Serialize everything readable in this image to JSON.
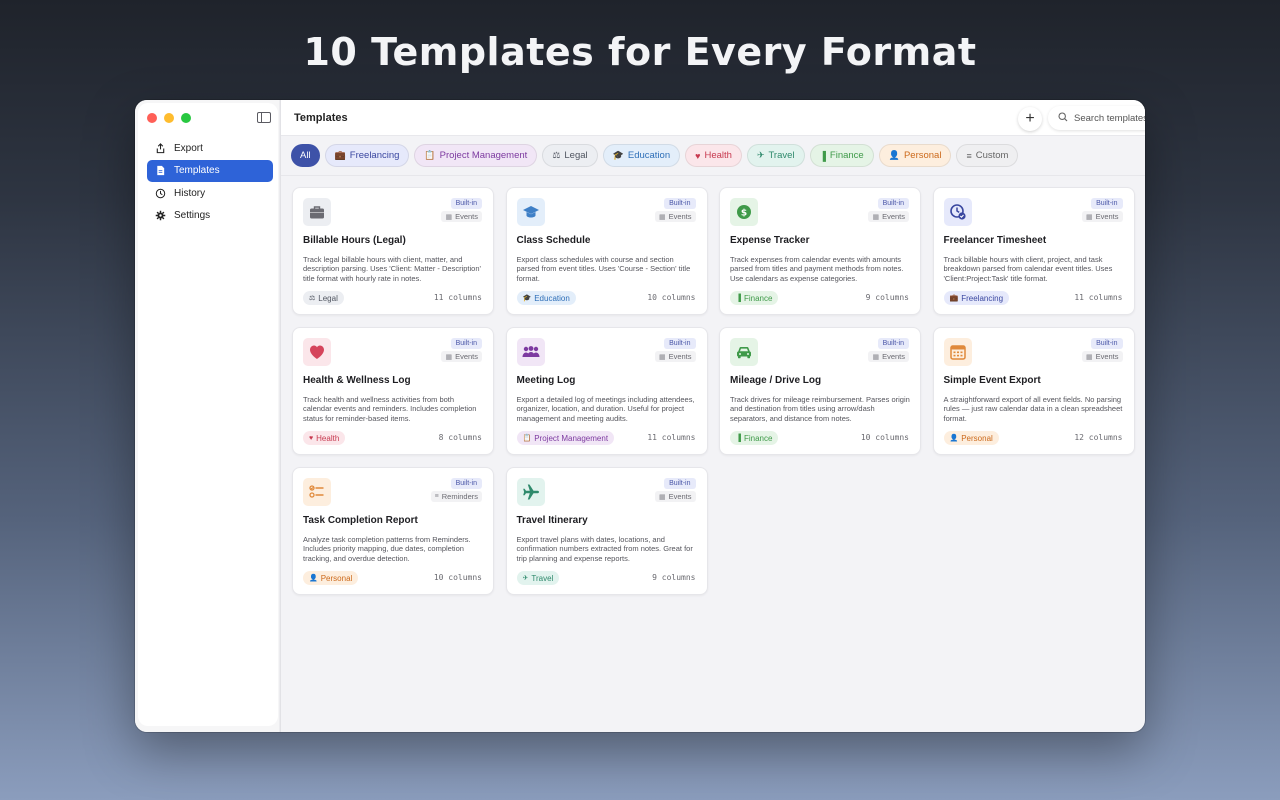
{
  "hero": {
    "title": "10 Templates for Every Format"
  },
  "sidebar": {
    "items": [
      {
        "label": "Export",
        "icon": "share-icon"
      },
      {
        "label": "Templates",
        "icon": "document-icon",
        "active": true
      },
      {
        "label": "History",
        "icon": "clock-icon"
      },
      {
        "label": "Settings",
        "icon": "gear-icon"
      }
    ]
  },
  "toolbar": {
    "title": "Templates",
    "add_label": "+",
    "search_placeholder": "Search templates",
    "search_value": ""
  },
  "filters": [
    {
      "label": "All",
      "icon": "",
      "theme": "all"
    },
    {
      "label": "Freelancing",
      "icon": "💼",
      "theme": "c-free"
    },
    {
      "label": "Project Management",
      "icon": "📋",
      "theme": "c-pm"
    },
    {
      "label": "Legal",
      "icon": "⚖",
      "theme": "c-legal"
    },
    {
      "label": "Education",
      "icon": "🎓",
      "theme": "c-edu"
    },
    {
      "label": "Health",
      "icon": "♥",
      "theme": "c-health"
    },
    {
      "label": "Travel",
      "icon": "✈",
      "theme": "c-travel"
    },
    {
      "label": "Finance",
      "icon": "▐",
      "theme": "c-fin"
    },
    {
      "label": "Personal",
      "icon": "👤",
      "theme": "c-pers"
    },
    {
      "label": "Custom",
      "icon": "≡",
      "theme": "c-custom"
    }
  ],
  "cards": [
    {
      "title": "Billable Hours (Legal)",
      "badge": "Built-in",
      "source": "Events",
      "desc": "Track legal billable hours with client, matter, and description parsing. Uses 'Client: Matter - Description' title format with hourly rate in notes.",
      "tag": "Legal",
      "tag_icon": "⚖",
      "theme": "c-legal",
      "columns": "11 columns",
      "icon": "briefcase-icon"
    },
    {
      "title": "Class Schedule",
      "badge": "Built-in",
      "source": "Events",
      "desc": "Export class schedules with course and section parsed from event titles. Uses 'Course - Section' title format.",
      "tag": "Education",
      "tag_icon": "🎓",
      "theme": "c-edu",
      "columns": "10 columns",
      "icon": "graduation-cap-icon"
    },
    {
      "title": "Expense Tracker",
      "badge": "Built-in",
      "source": "Events",
      "desc": "Track expenses from calendar events with amounts parsed from titles and payment methods from notes. Use calendars as expense categories.",
      "tag": "Finance",
      "tag_icon": "▐",
      "theme": "c-fin",
      "columns": "9 columns",
      "icon": "dollar-icon"
    },
    {
      "title": "Freelancer Timesheet",
      "badge": "Built-in",
      "source": "Events",
      "desc": "Track billable hours with client, project, and task breakdown parsed from calendar event titles. Uses 'Client:Project:Task' title format.",
      "tag": "Freelancing",
      "tag_icon": "💼",
      "theme": "c-free",
      "columns": "11 columns",
      "icon": "clock-check-icon"
    },
    {
      "title": "Health & Wellness Log",
      "badge": "Built-in",
      "source": "Events",
      "desc": "Track health and wellness activities from both calendar events and reminders. Includes completion status for reminder-based items.",
      "tag": "Health",
      "tag_icon": "♥",
      "theme": "c-health",
      "columns": "8 columns",
      "icon": "heart-icon"
    },
    {
      "title": "Meeting Log",
      "badge": "Built-in",
      "source": "Events",
      "desc": "Export a detailed log of meetings including attendees, organizer, location, and duration. Useful for project management and meeting audits.",
      "tag": "Project Management",
      "tag_icon": "📋",
      "theme": "c-pm",
      "columns": "11 columns",
      "icon": "people-icon"
    },
    {
      "title": "Mileage / Drive Log",
      "badge": "Built-in",
      "source": "Events",
      "desc": "Track drives for mileage reimbursement. Parses origin and destination from titles using arrow/dash separators, and distance from notes.",
      "tag": "Finance",
      "tag_icon": "▐",
      "theme": "c-fin",
      "columns": "10 columns",
      "icon": "car-icon"
    },
    {
      "title": "Simple Event Export",
      "badge": "Built-in",
      "source": "Events",
      "desc": "A straightforward export of all event fields. No parsing rules — just raw calendar data in a clean spreadsheet format.",
      "tag": "Personal",
      "tag_icon": "👤",
      "theme": "c-pers",
      "columns": "12 columns",
      "icon": "calendar-icon"
    },
    {
      "title": "Task Completion Report",
      "badge": "Built-in",
      "source": "Reminders",
      "desc": "Analyze task completion patterns from Reminders. Includes priority mapping, due dates, completion tracking, and overdue detection.",
      "tag": "Personal",
      "tag_icon": "👤",
      "theme": "c-pers",
      "columns": "10 columns",
      "icon": "checklist-icon"
    },
    {
      "title": "Travel Itinerary",
      "badge": "Built-in",
      "source": "Events",
      "desc": "Export travel plans with dates, locations, and confirmation numbers extracted from notes. Great for trip planning and expense reports.",
      "tag": "Travel",
      "tag_icon": "✈",
      "theme": "c-travel",
      "columns": "9 columns",
      "icon": "airplane-icon"
    }
  ]
}
